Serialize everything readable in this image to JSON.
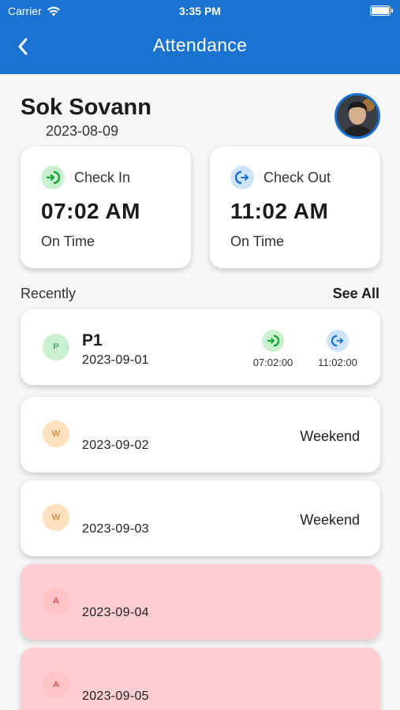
{
  "status_bar": {
    "carrier": "Carrier",
    "time": "3:35 PM"
  },
  "header": {
    "title": "Attendance"
  },
  "user": {
    "name": "Sok Sovann",
    "date": "2023-08-09"
  },
  "check_in": {
    "label": "Check In",
    "time": "07:02 AM",
    "status": "On Time"
  },
  "check_out": {
    "label": "Check Out",
    "time": "11:02 AM",
    "status": "On Time"
  },
  "recent": {
    "label": "Recently",
    "see_all": "See All",
    "items": [
      {
        "badge": "P",
        "title": "P1",
        "date": "2023-09-01",
        "check_in": "07:02:00",
        "check_out": "11:02:00"
      },
      {
        "badge": "W",
        "date": "2023-09-02",
        "status": "Weekend"
      },
      {
        "badge": "W",
        "date": "2023-09-03",
        "status": "Weekend"
      },
      {
        "badge": "A",
        "date": "2023-09-04"
      },
      {
        "badge": "A",
        "date": "2023-09-05"
      }
    ]
  },
  "colors": {
    "primary": "#1a73d1",
    "present": "#c9f1cf",
    "weekend": "#fde0bd",
    "absent": "#ffcdd2"
  }
}
